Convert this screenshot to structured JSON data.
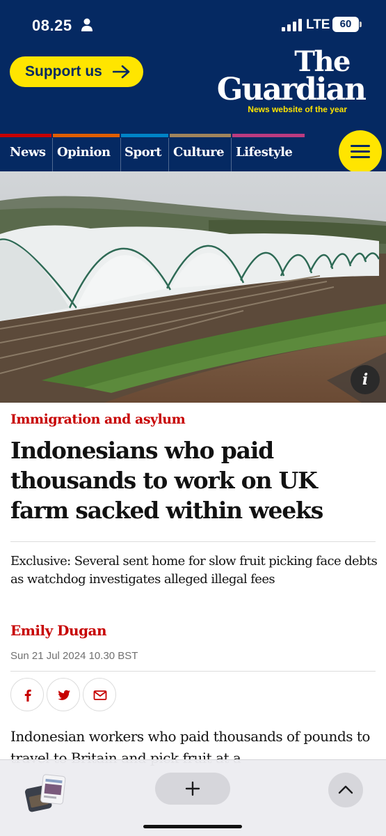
{
  "status_bar": {
    "time": "08.25",
    "network": "LTE",
    "battery": "60",
    "icons": [
      "person-icon",
      "signal-icon"
    ]
  },
  "header": {
    "support_label": "Support us",
    "logo_line1": "The",
    "logo_line2": "Guardian",
    "tagline": "News website of the year",
    "brand_color": "#052962",
    "accent_color": "#ffe500"
  },
  "nav": {
    "items": [
      {
        "label": "News",
        "color": "#c70000"
      },
      {
        "label": "Opinion",
        "color": "#e05e00"
      },
      {
        "label": "Sport",
        "color": "#0084c6"
      },
      {
        "label": "Culture",
        "color": "#a1845c"
      },
      {
        "label": "Lifestyle",
        "color": "#bb3b80"
      }
    ],
    "menu_icon": "hamburger-icon"
  },
  "hero": {
    "description": "polytunnels-field-photo",
    "info_label": "i"
  },
  "article": {
    "kicker": "Immigration and asylum",
    "headline": "Indonesians who paid thousands to work on UK farm sacked within weeks",
    "standfirst": "Exclusive: Several sent home for slow fruit picking face debts as watchdog investigates alleged illegal fees",
    "byline": "Emily Dugan",
    "date": "Sun 21 Jul 2024 10.30 BST",
    "share_icons": [
      "facebook-icon",
      "twitter-icon",
      "email-icon"
    ],
    "body_start": "Indonesian workers who paid thousands of pounds to travel to Britain and pick fruit at a",
    "accent_red": "#c70000"
  },
  "toolbar": {
    "icons": [
      "tabs-thumbnail-icon",
      "plus-icon",
      "chevron-up-icon"
    ]
  }
}
